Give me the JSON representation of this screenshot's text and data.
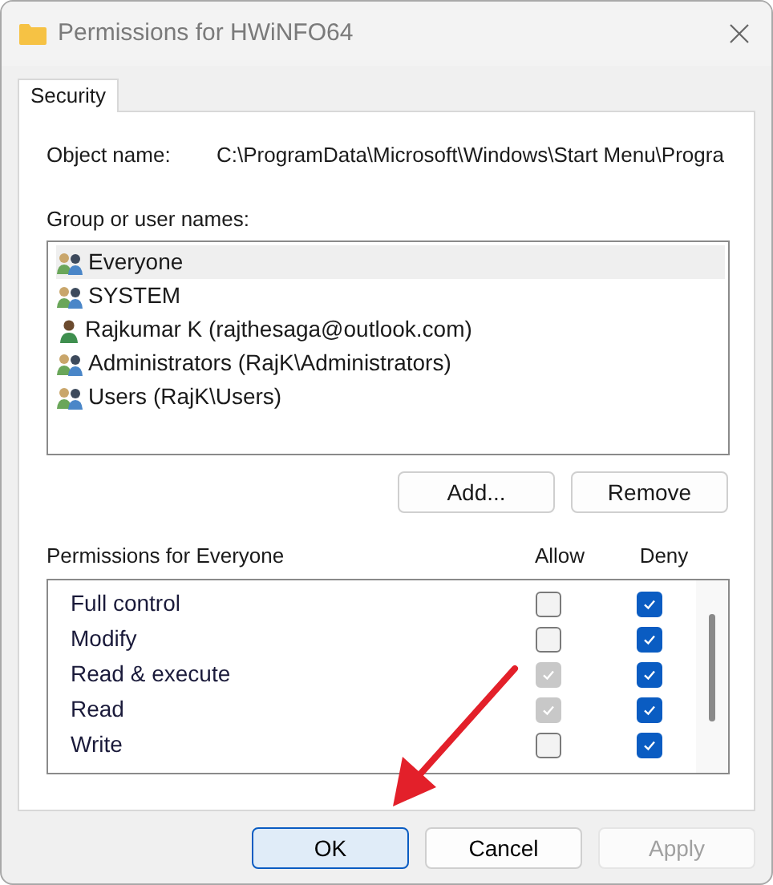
{
  "window": {
    "title": "Permissions for HWiNFO64"
  },
  "tabs": [
    {
      "label": "Security",
      "selected": true
    }
  ],
  "object_name": {
    "label": "Object name:",
    "value": "C:\\ProgramData\\Microsoft\\Windows\\Start Menu\\Progra"
  },
  "groups": {
    "label": "Group or user names:",
    "items": [
      {
        "name": "Everyone",
        "kind": "group",
        "selected": true
      },
      {
        "name": "SYSTEM",
        "kind": "group",
        "selected": false
      },
      {
        "name": "Rajkumar K (rajthesaga@outlook.com)",
        "kind": "user",
        "selected": false
      },
      {
        "name": "Administrators (RajK\\Administrators)",
        "kind": "group",
        "selected": false
      },
      {
        "name": "Users (RajK\\Users)",
        "kind": "group",
        "selected": false
      }
    ],
    "buttons": [
      "Add...",
      "Remove"
    ]
  },
  "permissions": {
    "label": "Permissions for Everyone",
    "columns": [
      "Allow",
      "Deny"
    ],
    "rows": [
      {
        "name": "Full control",
        "allow": {
          "checked": false,
          "disabled": false
        },
        "deny": {
          "checked": true,
          "disabled": false
        }
      },
      {
        "name": "Modify",
        "allow": {
          "checked": false,
          "disabled": false
        },
        "deny": {
          "checked": true,
          "disabled": false
        }
      },
      {
        "name": "Read & execute",
        "allow": {
          "checked": true,
          "disabled": true
        },
        "deny": {
          "checked": true,
          "disabled": false
        }
      },
      {
        "name": "Read",
        "allow": {
          "checked": true,
          "disabled": true
        },
        "deny": {
          "checked": true,
          "disabled": false
        }
      },
      {
        "name": "Write",
        "allow": {
          "checked": false,
          "disabled": false
        },
        "deny": {
          "checked": true,
          "disabled": false
        }
      }
    ]
  },
  "footer_buttons": [
    {
      "label": "OK",
      "kind": "default",
      "disabled": false
    },
    {
      "label": "Cancel",
      "kind": "normal",
      "disabled": false
    },
    {
      "label": "Apply",
      "kind": "normal",
      "disabled": true
    }
  ]
}
